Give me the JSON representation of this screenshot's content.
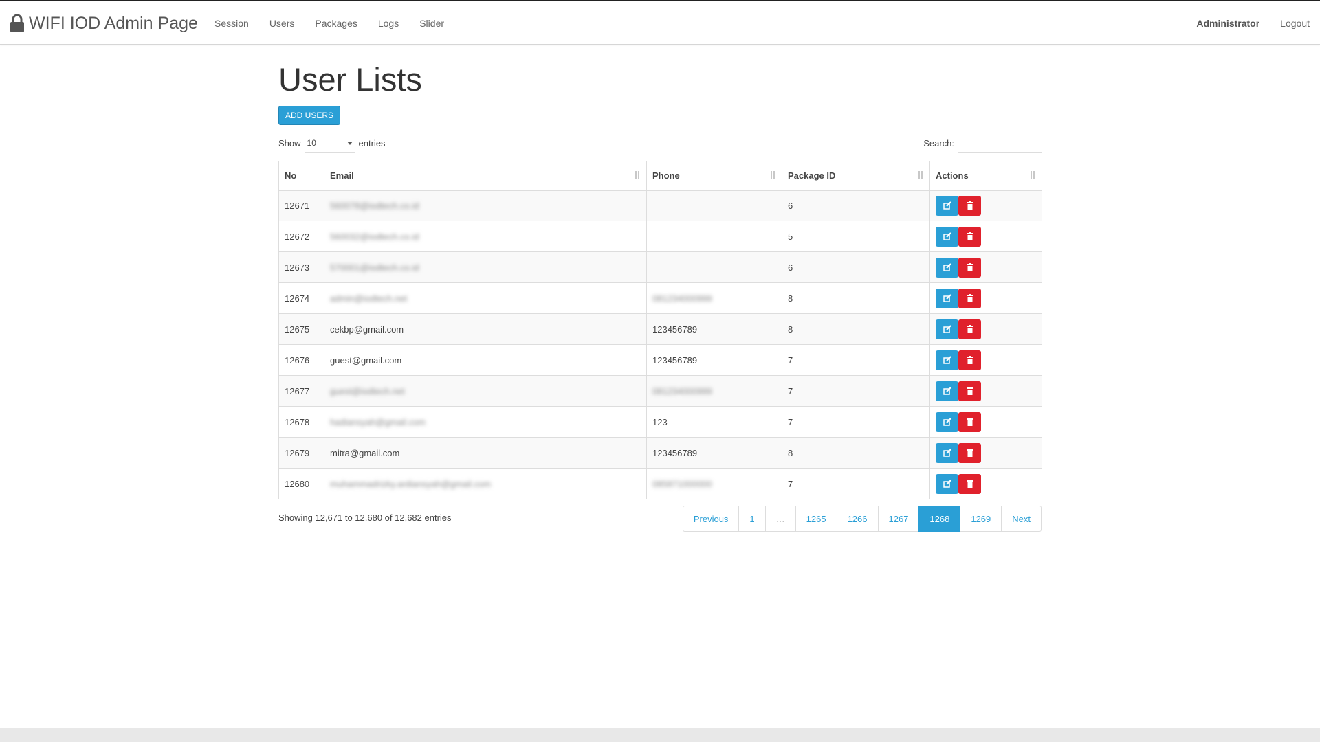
{
  "navbar": {
    "brand": "WIFI IOD Admin Page",
    "links": [
      "Session",
      "Users",
      "Packages",
      "Logs",
      "Slider"
    ],
    "user": "Administrator",
    "logout": "Logout"
  },
  "page": {
    "title": "User Lists",
    "add_button": "ADD USERS",
    "show_label": "Show",
    "entries_value": "10",
    "entries_label": "entries",
    "search_label": "Search:",
    "search_value": ""
  },
  "table": {
    "columns": [
      "No",
      "Email",
      "Phone",
      "Package ID",
      "Actions"
    ],
    "rows": [
      {
        "no": "12671",
        "email": "560078@iodtech.co.id",
        "phone": "",
        "package": "6",
        "blur_email": true,
        "blur_phone": false
      },
      {
        "no": "12672",
        "email": "560032@iodtech.co.id",
        "phone": "",
        "package": "5",
        "blur_email": true,
        "blur_phone": false
      },
      {
        "no": "12673",
        "email": "570001@iodtech.co.id",
        "phone": "",
        "package": "6",
        "blur_email": true,
        "blur_phone": false
      },
      {
        "no": "12674",
        "email": "admin@iodtech.net",
        "phone": "081234000999",
        "package": "8",
        "blur_email": true,
        "blur_phone": true
      },
      {
        "no": "12675",
        "email": "cekbp@gmail.com",
        "phone": "123456789",
        "package": "8",
        "blur_email": false,
        "blur_phone": false
      },
      {
        "no": "12676",
        "email": "guest@gmail.com",
        "phone": "123456789",
        "package": "7",
        "blur_email": false,
        "blur_phone": false
      },
      {
        "no": "12677",
        "email": "guest@iodtech.net",
        "phone": "081234000999",
        "package": "7",
        "blur_email": true,
        "blur_phone": true
      },
      {
        "no": "12678",
        "email": "hadiansyah@gmail.com",
        "phone": "123",
        "package": "7",
        "blur_email": true,
        "blur_phone": false
      },
      {
        "no": "12679",
        "email": "mitra@gmail.com",
        "phone": "123456789",
        "package": "8",
        "blur_email": false,
        "blur_phone": false
      },
      {
        "no": "12680",
        "email": "muhammadrizky.ardiansyah@gmail.com",
        "phone": "085871000000",
        "package": "7",
        "blur_email": true,
        "blur_phone": true
      }
    ]
  },
  "footer": {
    "info": "Showing 12,671 to 12,680 of 12,682 entries",
    "pages": [
      {
        "label": "Previous",
        "state": "normal"
      },
      {
        "label": "1",
        "state": "normal"
      },
      {
        "label": "…",
        "state": "disabled"
      },
      {
        "label": "1265",
        "state": "normal"
      },
      {
        "label": "1266",
        "state": "normal"
      },
      {
        "label": "1267",
        "state": "normal"
      },
      {
        "label": "1268",
        "state": "active"
      },
      {
        "label": "1269",
        "state": "normal"
      },
      {
        "label": "Next",
        "state": "normal"
      }
    ]
  },
  "colors": {
    "primary": "#2a9fd6",
    "danger": "#e0212c"
  },
  "icons": {
    "brand": "lock-icon",
    "edit": "edit-icon",
    "delete": "trash-icon",
    "sort": "sort-icon",
    "select": "caret-down-icon"
  }
}
